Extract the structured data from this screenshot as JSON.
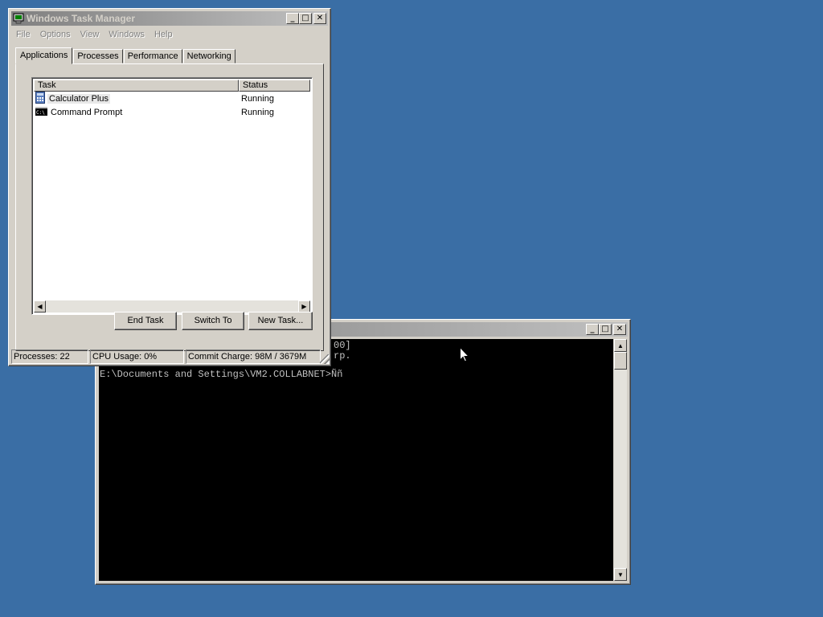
{
  "task_manager": {
    "title": "Windows Task Manager",
    "menu": [
      "File",
      "Options",
      "View",
      "Windows",
      "Help"
    ],
    "tabs": [
      "Applications",
      "Processes",
      "Performance",
      "Networking"
    ],
    "columns": {
      "task": "Task",
      "status": "Status"
    },
    "rows": [
      {
        "task": "Calculator Plus",
        "status": "Running",
        "icon": "calculator-icon",
        "selected": true
      },
      {
        "task": "Command Prompt",
        "status": "Running",
        "icon": "console-icon",
        "selected": false
      }
    ],
    "buttons": {
      "end_task": "End Task",
      "switch_to": "Switch To",
      "new_task": "New Task..."
    },
    "statusbar": {
      "processes": "Processes: 22",
      "cpu": "CPU Usage: 0%",
      "commit": "Commit Charge: 98M / 3679M"
    }
  },
  "command_prompt": {
    "title": "",
    "lines": [
      "00]",
      "rp.",
      "E:\\Documents and Settings\\VM2.COLLABNET>Ññ"
    ]
  },
  "colors": {
    "desktop": "#3a6ea5",
    "inactive_title_start": "#808080",
    "console_bg": "#000000",
    "console_fg": "#c0c0c0"
  }
}
